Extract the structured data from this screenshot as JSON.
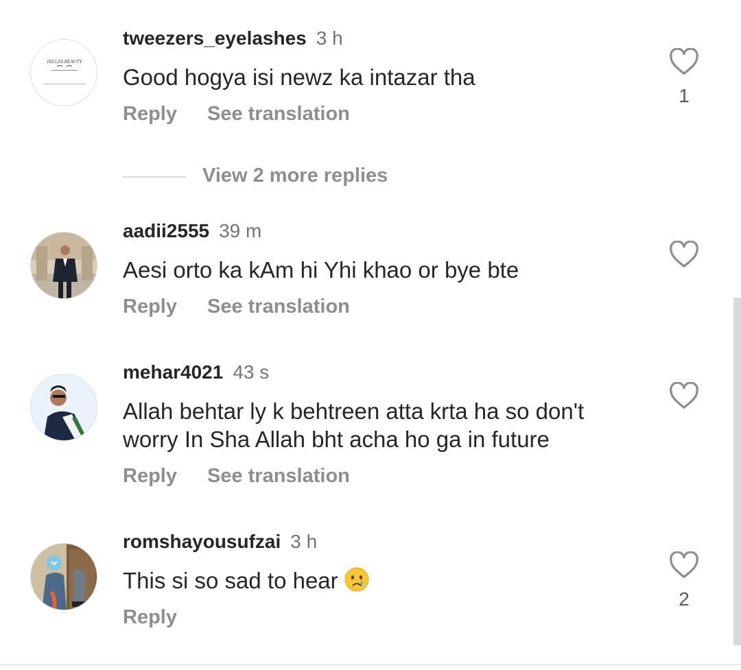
{
  "comments": [
    {
      "username": "tweezers_eyelashes",
      "time": "3 h",
      "text": "Good hogya isi newz ka intazar tha",
      "reply_label": "Reply",
      "translate_label": "See translation",
      "like_count": "1",
      "avatar_text": "HILLZA BEAUTY"
    },
    {
      "username": "aadii2555",
      "time": "39 m",
      "text": "Aesi orto ka kAm hi Yhi khao or bye bte",
      "reply_label": "Reply",
      "translate_label": "See translation"
    },
    {
      "username": "mehar4021",
      "time": "43 s",
      "text_line1": "Allah behtar ly k behtreen atta krta ha so don't",
      "text_line2": "worry In Sha Allah bht acha ho ga in future",
      "reply_label": "Reply",
      "translate_label": "See translation"
    },
    {
      "username": "romshayousufzai",
      "time": "3 h",
      "text": "This si so sad to hear",
      "emoji": "crying-face",
      "reply_label": "Reply",
      "like_count": "2"
    }
  ],
  "view_more_replies": "View 2 more replies",
  "colors": {
    "text": "#262626",
    "secondary": "#8e8e8e",
    "heart_outline": "#8e8e8e"
  }
}
